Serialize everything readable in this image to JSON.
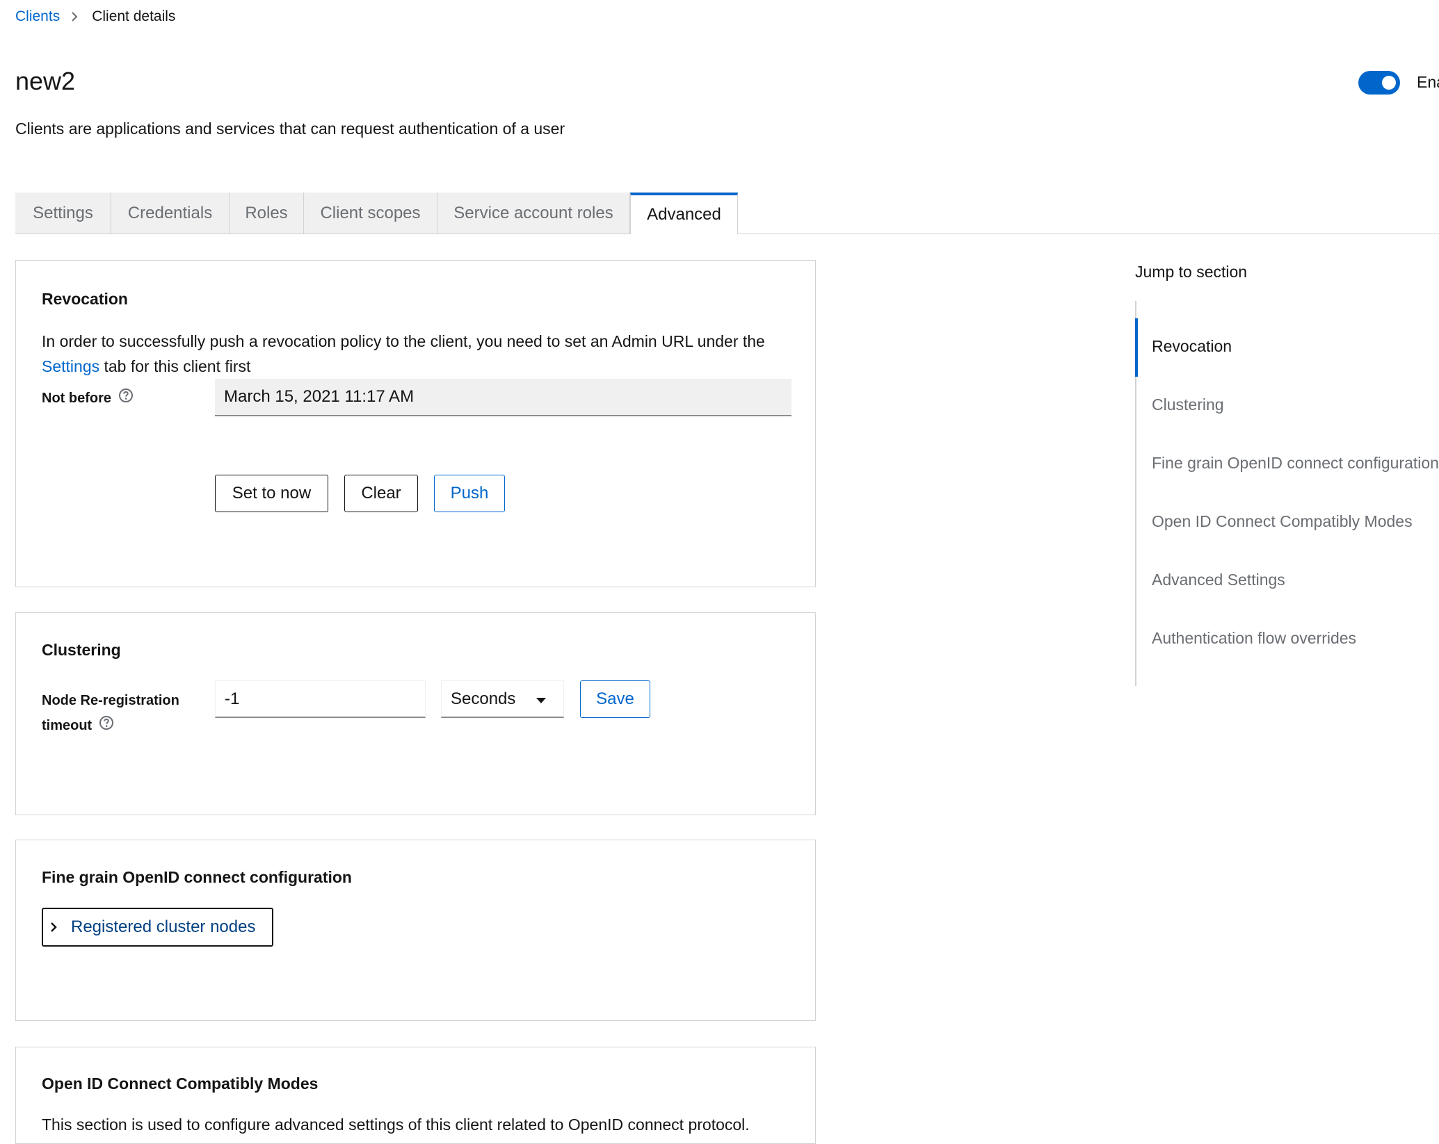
{
  "breadcrumb": {
    "parent": "Clients",
    "current": "Client details"
  },
  "header": {
    "title": "new2",
    "description": "Clients are applications and services that can request authentication of a user",
    "toggle_label": "Ena",
    "toggle_on": true
  },
  "tabs": [
    {
      "label": "Settings",
      "active": false
    },
    {
      "label": "Credentials",
      "active": false
    },
    {
      "label": "Roles",
      "active": false
    },
    {
      "label": "Client scopes",
      "active": false
    },
    {
      "label": "Service account roles",
      "active": false
    },
    {
      "label": "Advanced",
      "active": true
    }
  ],
  "revocation": {
    "title": "Revocation",
    "text_before": "In order to successfully push a revocation policy to the client, you need to set an Admin URL under the ",
    "settings_link": "Settings",
    "text_after": " tab for this client first",
    "not_before_label": "Not before",
    "not_before_value": "March 15, 2021 11:17 AM",
    "set_to_now": "Set to now",
    "clear": "Clear",
    "push": "Push"
  },
  "clustering": {
    "title": "Clustering",
    "label_line1": "Node Re-registration",
    "label_line2": "timeout",
    "value": "-1",
    "unit": "Seconds",
    "save": "Save"
  },
  "fine_grain": {
    "title": "Fine grain OpenID connect configuration",
    "expandable": "Registered cluster nodes"
  },
  "compat": {
    "title": "Open ID Connect Compatibly Modes",
    "description": "This section is used to configure advanced settings of this client related to OpenID connect protocol."
  },
  "jump": {
    "title": "Jump to section",
    "items": [
      "Revocation",
      "Clustering",
      "Fine grain OpenID connect configuration",
      "Open ID Connect Compatibly Modes",
      "Advanced Settings",
      "Authentication flow overrides"
    ],
    "active_index": 0
  },
  "colors": {
    "accent": "#0066cc",
    "text": "#151515",
    "muted": "#6a6e73",
    "border": "#d2d2d2"
  }
}
